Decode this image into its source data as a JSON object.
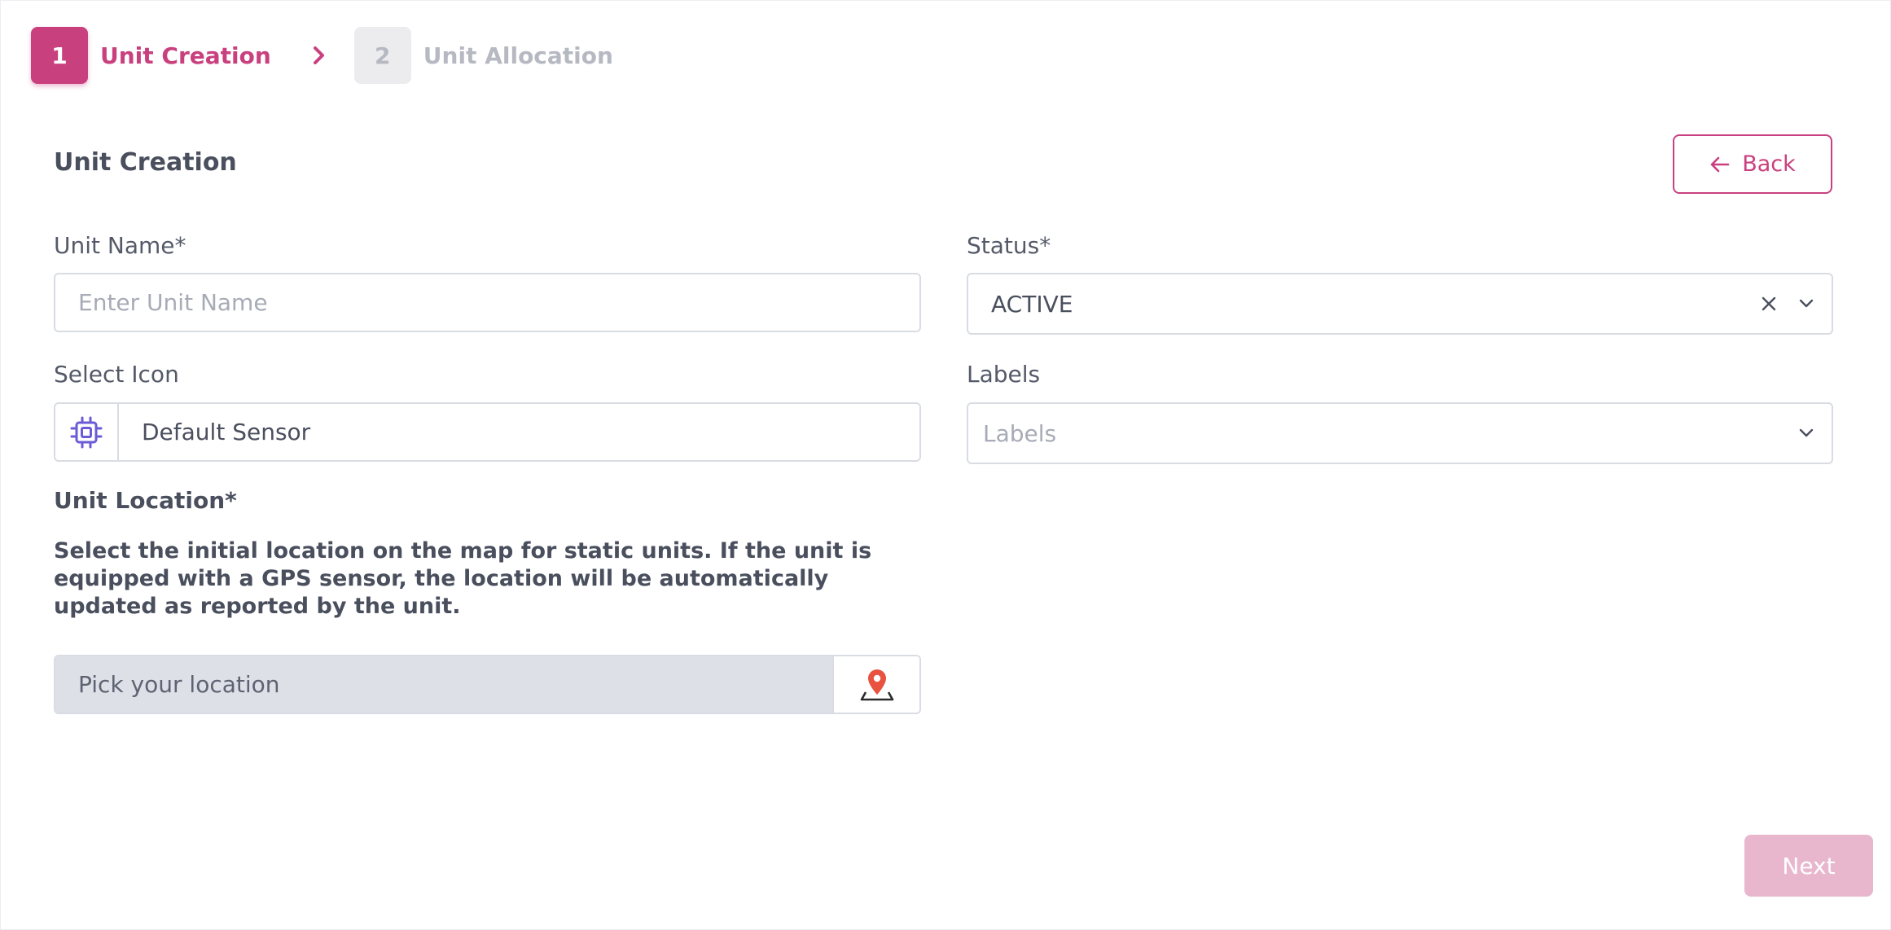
{
  "stepper": {
    "steps": [
      {
        "number": "1",
        "label": "Unit Creation",
        "state": "active"
      },
      {
        "number": "2",
        "label": "Unit Allocation",
        "state": "inactive"
      }
    ],
    "separator_icon": "chevron-right-icon"
  },
  "header": {
    "title": "Unit Creation",
    "back_label": "Back",
    "back_icon": "arrow-left-icon"
  },
  "form": {
    "unit_name": {
      "label": "Unit Name*",
      "placeholder": "Enter Unit Name",
      "value": ""
    },
    "status": {
      "label": "Status*",
      "value": "ACTIVE",
      "clear_icon": "close-icon",
      "dropdown_icon": "chevron-down-icon"
    },
    "icon": {
      "label": "Select Icon",
      "value": "Default Sensor",
      "icon": "chip-icon"
    },
    "labels": {
      "label": "Labels",
      "placeholder": "Labels",
      "dropdown_icon": "chevron-down-icon"
    },
    "location": {
      "title": "Unit Location*",
      "description": "Select the initial location on the map for static units. If the unit is equipped with a GPS sensor, the location will be automatically updated as reported by the unit.",
      "placeholder": "Pick your location",
      "pick_icon": "map-pin-icon"
    }
  },
  "footer": {
    "next_label": "Next"
  },
  "colors": {
    "accent": "#c9407f",
    "accent_disabled": "#e8b7cd",
    "inactive_step_bg": "#ececee",
    "inactive_step_text": "#b6b9c2",
    "icon_purple": "#6a5cd6",
    "pin_red": "#e8523f"
  }
}
